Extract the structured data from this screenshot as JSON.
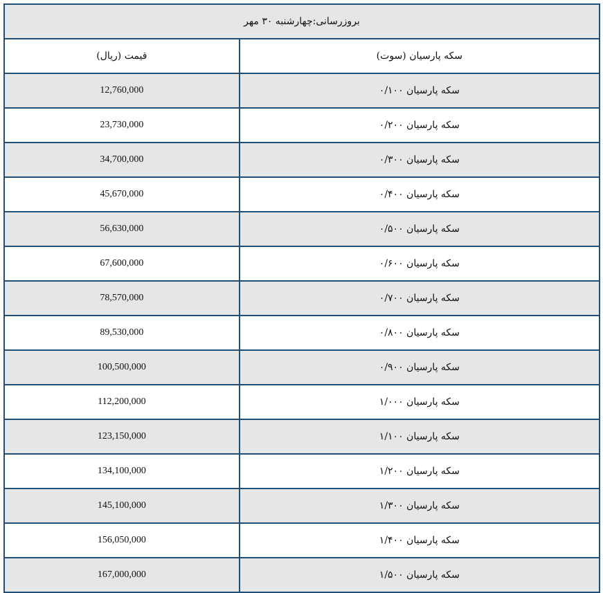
{
  "title": "بروزرسانی:چهارشنبه ۳۰ مهر",
  "headers": {
    "name": "سکه پارسیان (سوت)",
    "price": "قیمت (ریال)"
  },
  "rows": [
    {
      "name": "سکه پارسیان ۰/۱۰۰",
      "price": "12,760,000"
    },
    {
      "name": "سکه پارسیان ۰/۲۰۰",
      "price": "23,730,000"
    },
    {
      "name": "سکه پارسیان ۰/۳۰۰",
      "price": "34,700,000"
    },
    {
      "name": "سکه پارسیان ۰/۴۰۰",
      "price": "45,670,000"
    },
    {
      "name": "سکه پارسیان ۰/۵۰۰",
      "price": "56,630,000"
    },
    {
      "name": "سکه پارسیان ۰/۶۰۰",
      "price": "67,600,000"
    },
    {
      "name": "سکه پارسیان ۰/۷۰۰",
      "price": "78,570,000"
    },
    {
      "name": "سکه پارسیان ۰/۸۰۰",
      "price": "89,530,000"
    },
    {
      "name": "سکه پارسیان ۰/۹۰۰",
      "price": "100,500,000"
    },
    {
      "name": "سکه پارسیان ۱/۰۰۰",
      "price": "112,200,000"
    },
    {
      "name": "سکه پارسیان ۱/۱۰۰",
      "price": "123,150,000"
    },
    {
      "name": "سکه پارسیان ۱/۲۰۰",
      "price": "134,100,000"
    },
    {
      "name": "سکه پارسیان ۱/۳۰۰",
      "price": "145,100,000"
    },
    {
      "name": "سکه پارسیان ۱/۴۰۰",
      "price": "156,050,000"
    },
    {
      "name": "سکه پارسیان ۱/۵۰۰",
      "price": "167,000,000"
    }
  ],
  "colors": {
    "border": "#1f4e79",
    "stripe": "#e6e6e6",
    "background": "#ffffff"
  }
}
